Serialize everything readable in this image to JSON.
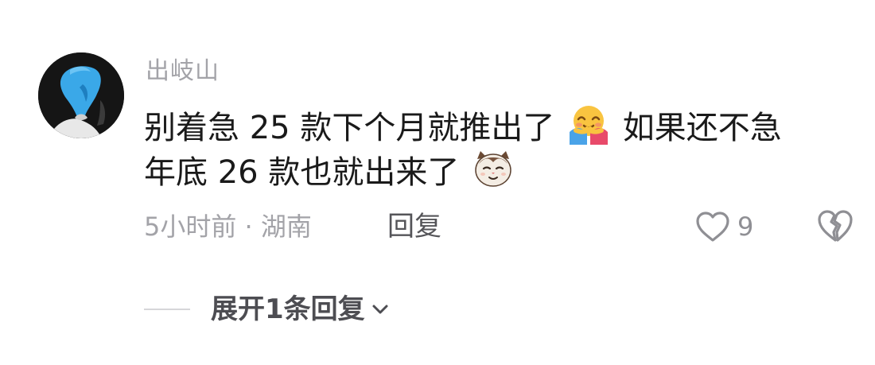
{
  "comment": {
    "username": "出岐山",
    "text_line1_part1": "别着急 25 款下个月就推出了",
    "text_line1_part2": "如果还不急",
    "text_line2": "年底 26 款也就出来了",
    "emoji_1": "hugging-face-icon",
    "emoji_2": "cat-face-icon",
    "meta": "5小时前 · 湖南",
    "reply_label": "回复",
    "like_count": "9"
  },
  "replies": {
    "expand_label": "展开1条回复"
  },
  "colors": {
    "username": "#a3a3a8",
    "text": "#1a1a1a",
    "meta": "#a3a3a8",
    "reply": "#555559",
    "icon": "#8f8f94",
    "avatar_bg": "#151515",
    "avatar_accent": "#3aa8e8"
  }
}
